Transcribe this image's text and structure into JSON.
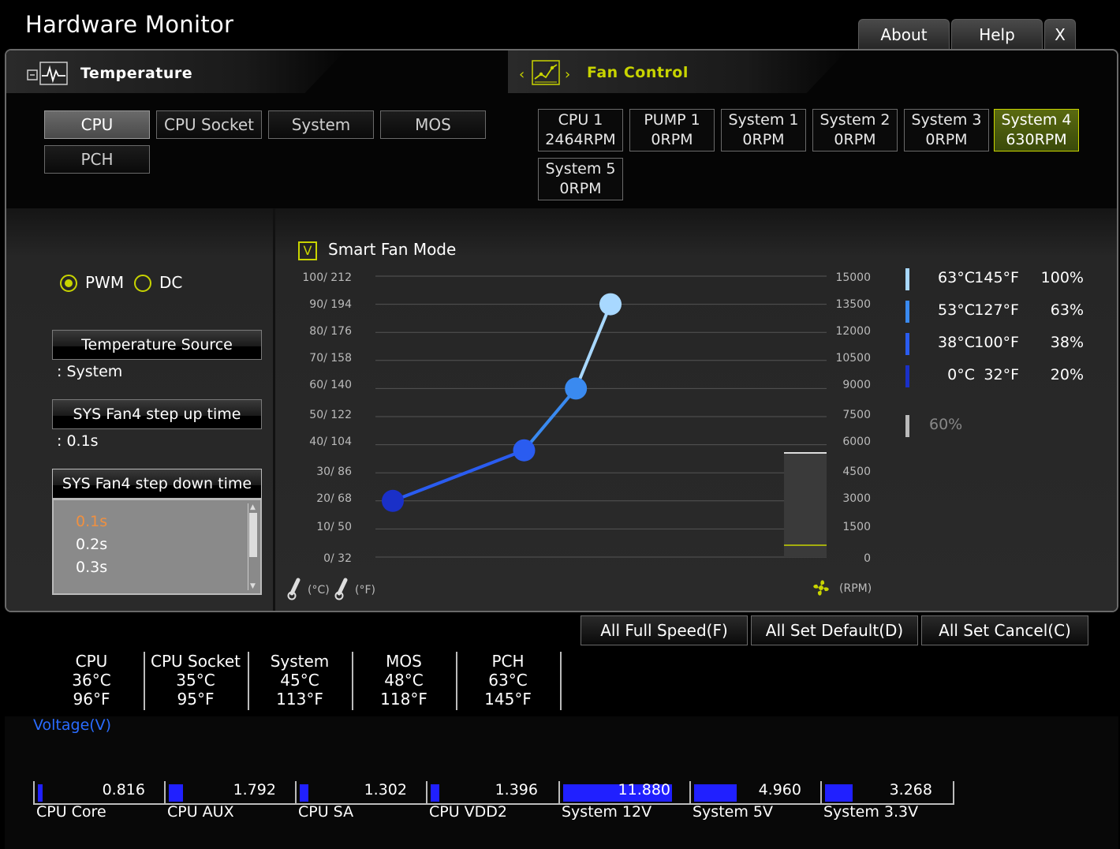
{
  "app": {
    "title": "Hardware Monitor"
  },
  "top_buttons": {
    "about": "About",
    "help": "Help",
    "close": "X"
  },
  "temperature": {
    "title": "Temperature",
    "tabs": [
      "CPU",
      "CPU Socket",
      "System",
      "MOS",
      "PCH"
    ],
    "active_tab": "CPU"
  },
  "fan_control": {
    "title": "Fan Control",
    "fans": [
      {
        "name": "CPU 1",
        "rpm": "2464RPM"
      },
      {
        "name": "PUMP 1",
        "rpm": "0RPM"
      },
      {
        "name": "System 1",
        "rpm": "0RPM"
      },
      {
        "name": "System 2",
        "rpm": "0RPM"
      },
      {
        "name": "System 3",
        "rpm": "0RPM"
      },
      {
        "name": "System 4",
        "rpm": "630RPM"
      },
      {
        "name": "System 5",
        "rpm": "0RPM"
      }
    ],
    "active_fan": "System 4"
  },
  "settings": {
    "mode_pwm": "PWM",
    "mode_dc": "DC",
    "selected_mode": "PWM",
    "temp_source_label": "Temperature Source",
    "temp_source_value": ": System",
    "step_up_label": "SYS Fan4 step up time",
    "step_up_value": ": 0.1s",
    "step_down_label": "SYS Fan4 step down time",
    "step_down_options": [
      "0.1s",
      "0.2s",
      "0.3s"
    ],
    "step_down_selected": "0.1s"
  },
  "smart_fan": {
    "label": "Smart Fan Mode",
    "checkbox": "V",
    "checked": true
  },
  "chart_data": {
    "type": "line",
    "left_axis_ticks": [
      "100/ 212",
      "90/ 194",
      "80/ 176",
      "70/ 158",
      "60/ 140",
      "50/ 122",
      "40/ 104",
      "30/  86",
      "20/  68",
      "10/  50",
      "0/  32"
    ],
    "right_axis_ticks": [
      "15000",
      "13500",
      "12000",
      "10500",
      "9000",
      "7500",
      "6000",
      "4500",
      "3000",
      "1500",
      "0"
    ],
    "left_axis_unit_c": "(°C)",
    "left_axis_unit_f": "(°F)",
    "right_axis_unit": "(RPM)",
    "ylim": [
      0,
      100
    ],
    "points": [
      {
        "temp_c": 0,
        "percent": 20,
        "color": "#1a30c8"
      },
      {
        "temp_c": 38,
        "percent": 38,
        "color": "#2a5cf0"
      },
      {
        "temp_c": 53,
        "percent": 60,
        "color": "#3a8af0"
      },
      {
        "temp_c": 63,
        "percent": 90,
        "color": "#a8d8ff"
      }
    ],
    "current_rpm": 630,
    "rpm_max": 15000
  },
  "legend": [
    {
      "c": "63°C",
      "f": "145°F",
      "pct": "100%",
      "color": "#a8d8ff"
    },
    {
      "c": "53°C",
      "f": "127°F",
      "pct": "63%",
      "color": "#3a8af0"
    },
    {
      "c": "38°C",
      "f": "100°F",
      "pct": "38%",
      "color": "#2a5cf0"
    },
    {
      "c": "0°C",
      "f": "32°F",
      "pct": "20%",
      "color": "#1a30c8"
    }
  ],
  "legend_extra": {
    "pct": "60%",
    "color": "#bbbbbb"
  },
  "bottom_buttons": {
    "full_speed": "All Full Speed(F)",
    "set_default": "All Set Default(D)",
    "set_cancel": "All Set Cancel(C)"
  },
  "temps": [
    {
      "name": "CPU",
      "c": "36°C",
      "f": "96°F"
    },
    {
      "name": "CPU Socket",
      "c": "35°C",
      "f": "95°F"
    },
    {
      "name": "System",
      "c": "45°C",
      "f": "113°F"
    },
    {
      "name": "MOS",
      "c": "48°C",
      "f": "118°F"
    },
    {
      "name": "PCH",
      "c": "63°C",
      "f": "145°F"
    }
  ],
  "voltage": {
    "title": "Voltage(V)",
    "items": [
      {
        "name": "CPU Core",
        "value": "0.816",
        "level": 0.04
      },
      {
        "name": "CPU AUX",
        "value": "1.792",
        "level": 0.11
      },
      {
        "name": "CPU SA",
        "value": "1.302",
        "level": 0.07
      },
      {
        "name": "CPU VDD2",
        "value": "1.396",
        "level": 0.07
      },
      {
        "name": "System 12V",
        "value": "11.880",
        "level": 0.86
      },
      {
        "name": "System 5V",
        "value": "4.960",
        "level": 0.34
      },
      {
        "name": "System 3.3V",
        "value": "3.268",
        "level": 0.22
      }
    ]
  },
  "colors": {
    "accent": "#c8d400",
    "voltage_bar": "#2020ff",
    "voltage_title": "#2a6cff"
  }
}
